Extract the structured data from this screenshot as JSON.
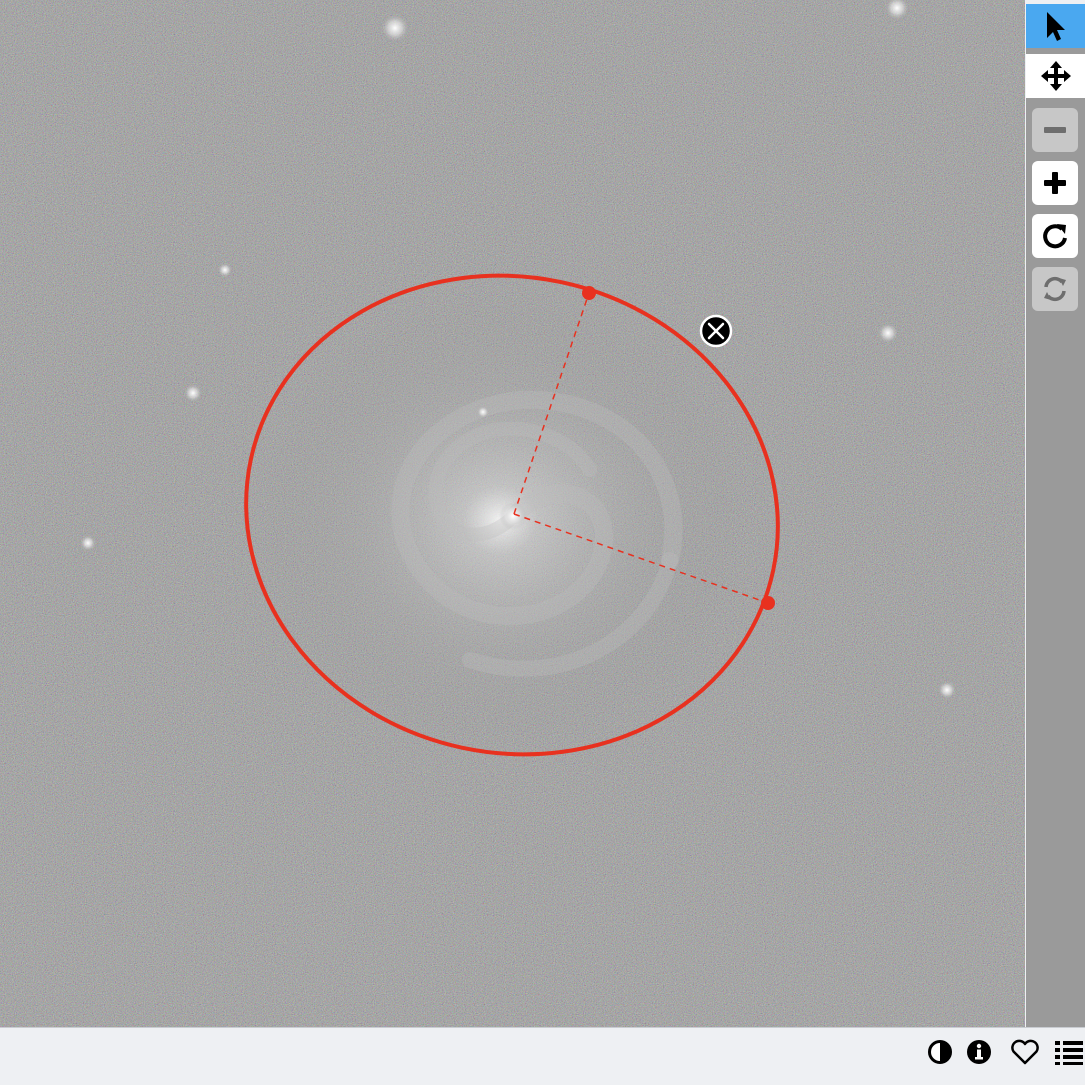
{
  "viewer": {
    "image_subject": "galaxy-image",
    "region_color": "#e8311f",
    "region_shape": "ellipse"
  },
  "toolbar": {
    "buttons": [
      {
        "name": "select-tool-button",
        "icon": "pointer-arrow-icon",
        "state": "active"
      },
      {
        "name": "pan-tool-button",
        "icon": "move-arrows-icon",
        "state": "normal"
      },
      {
        "name": "zoom-out-button",
        "icon": "minus-icon",
        "state": "disabled"
      },
      {
        "name": "zoom-in-button",
        "icon": "plus-icon",
        "state": "normal"
      },
      {
        "name": "reset-view-button",
        "icon": "rotate-cw-icon",
        "state": "normal"
      },
      {
        "name": "refresh-button",
        "icon": "sync-icon",
        "state": "disabled"
      }
    ]
  },
  "bottom_bar": {
    "icons": [
      "contrast-icon",
      "info-icon",
      "heart-icon",
      "list-icon"
    ]
  }
}
